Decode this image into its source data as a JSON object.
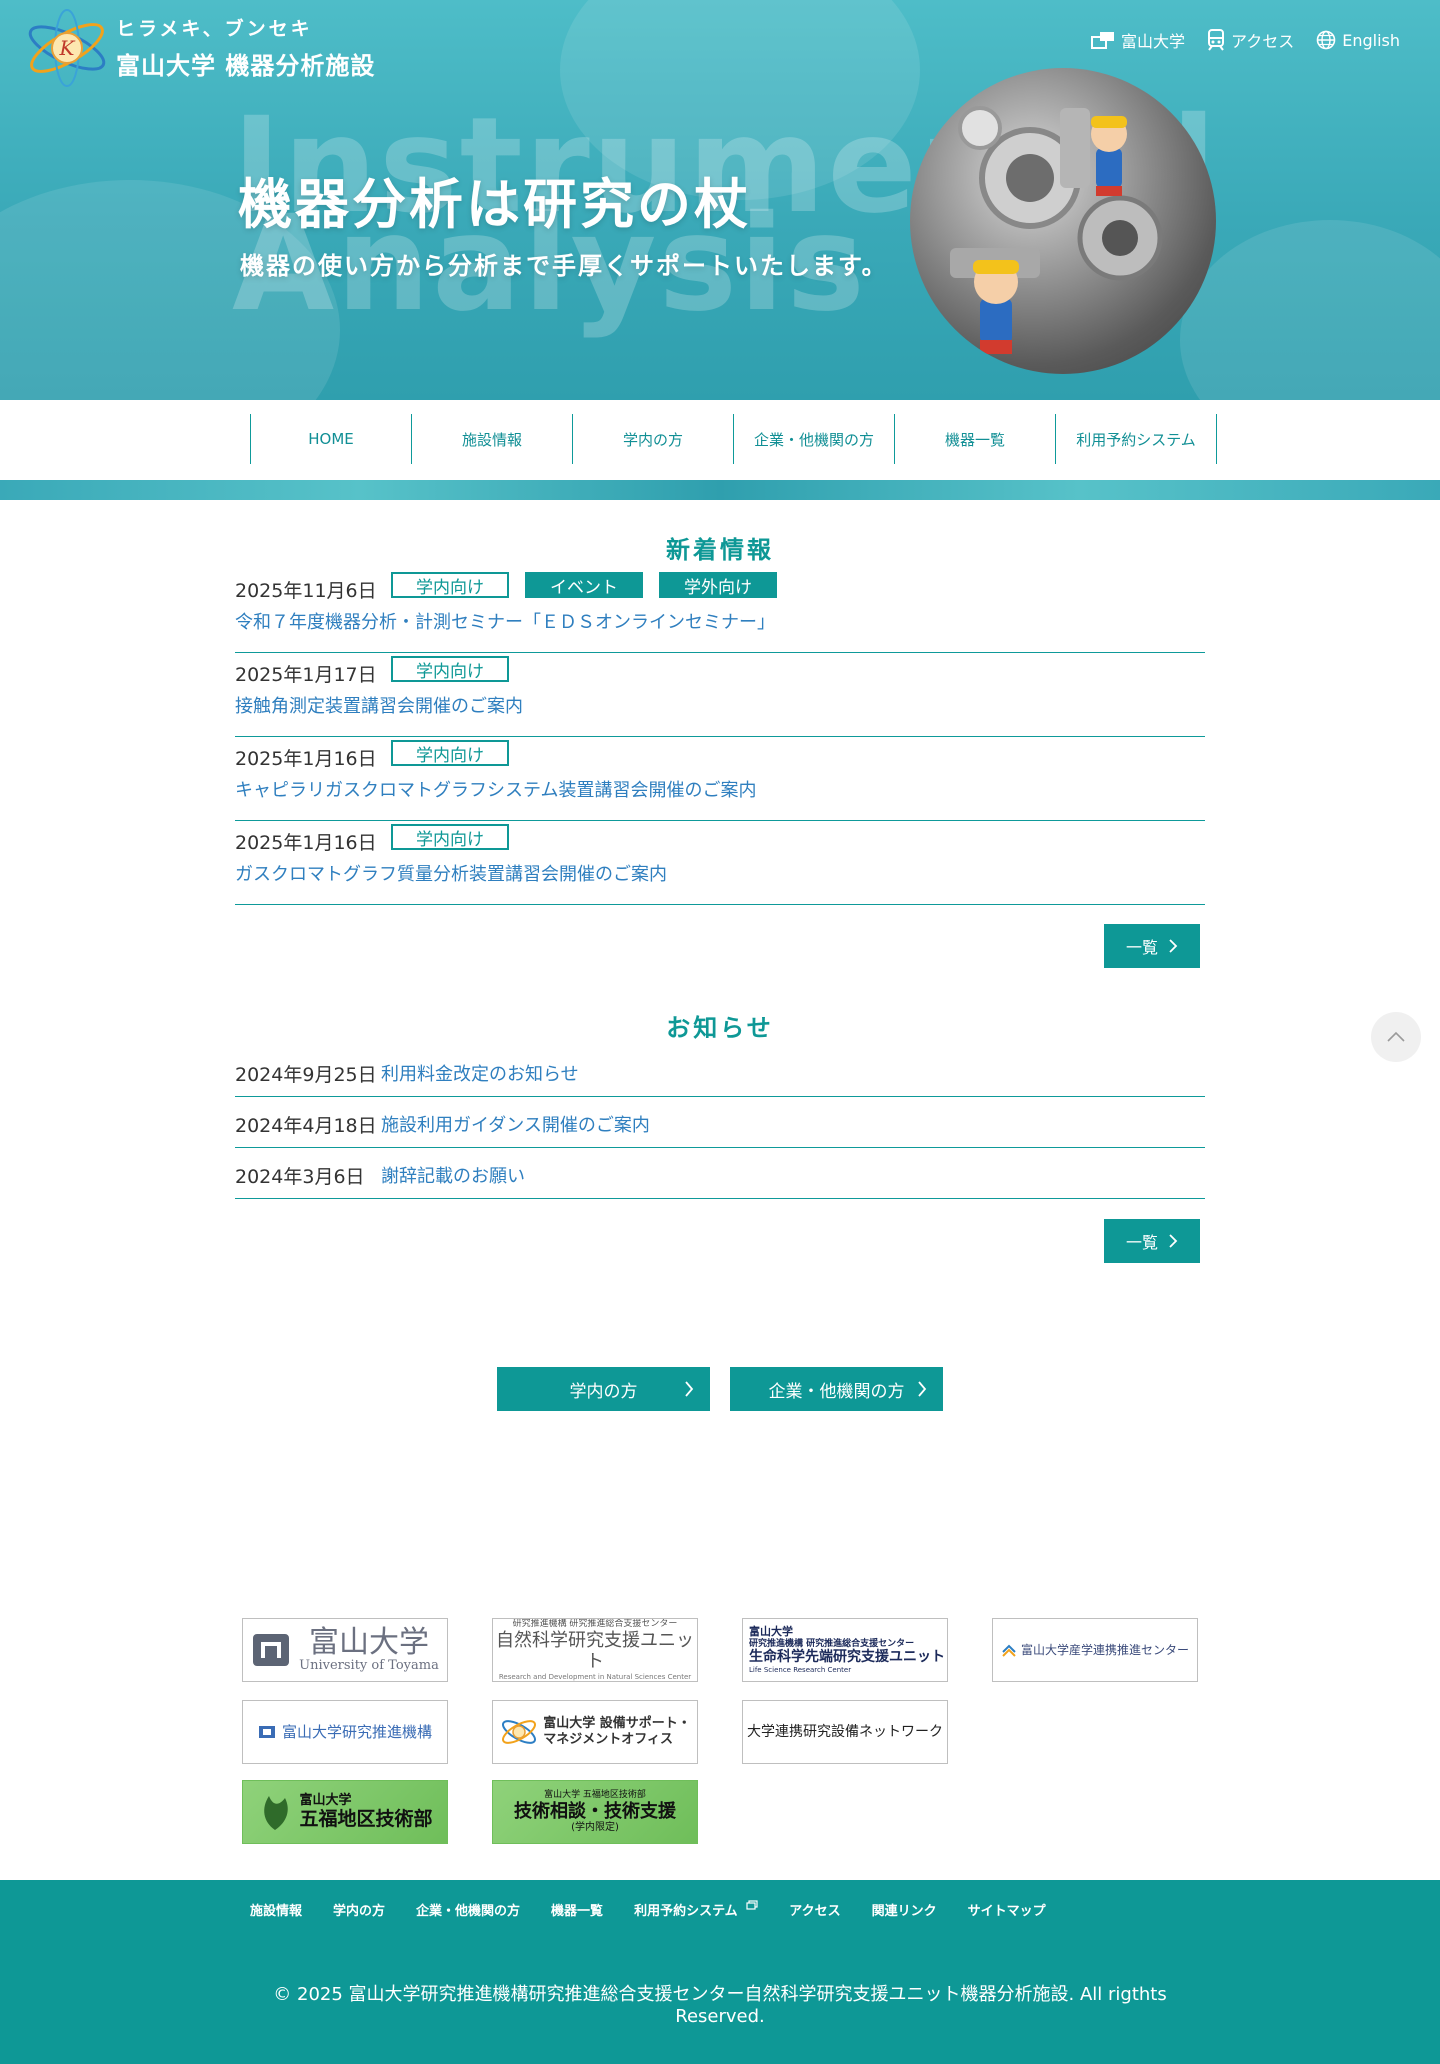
{
  "header": {
    "catchphrase": "ヒラメキ、ブンセキ",
    "site_name": "富山大学  機器分析施設",
    "top_links": [
      {
        "label": "富山大学",
        "icon": "building-icon"
      },
      {
        "label": "アクセス",
        "icon": "train-icon"
      },
      {
        "label": "English",
        "icon": "globe-icon"
      }
    ]
  },
  "hero": {
    "bg_word_1": "Instrumental",
    "bg_word_2": "Analysis",
    "title": "機器分析は研究の杖",
    "subtitle": "機器の使い方から分析まで手厚くサポートいたします。"
  },
  "nav": {
    "items": [
      "HOME",
      "施設情報",
      "学内の方",
      "企業・他機関の方",
      "機器一覧",
      "利用予約システム"
    ]
  },
  "news": {
    "heading": "新着情報",
    "items": [
      {
        "date": "2025年11月6日",
        "tags": [
          "学内向け",
          "イベント",
          "学外向け"
        ],
        "title": "令和７年度機器分析・計測セミナー「ＥＤＳオンラインセミナー」"
      },
      {
        "date": "2025年1月17日",
        "tags": [
          "学内向け"
        ],
        "title": "接触角測定装置講習会開催のご案内"
      },
      {
        "date": "2025年1月16日",
        "tags": [
          "学内向け"
        ],
        "title": "キャピラリガスクロマトグラフシステム装置講習会開催のご案内"
      },
      {
        "date": "2025年1月16日",
        "tags": [
          "学内向け"
        ],
        "title": "ガスクロマトグラフ質量分析装置講習会開催のご案内"
      }
    ],
    "more_label": "一覧"
  },
  "notices": {
    "heading": "お知らせ",
    "items": [
      {
        "date": "2024年9月25日",
        "title": "利用料金改定のお知らせ"
      },
      {
        "date": "2024年4月18日",
        "title": "施設利用ガイダンス開催のご案内"
      },
      {
        "date": "2024年3月6日",
        "title": "謝辞記載のお願い"
      }
    ],
    "more_label": "一覧"
  },
  "cta": {
    "internal": "学内の方",
    "external": "企業・他機関の方"
  },
  "banners": {
    "uoft_name": "富山大学",
    "uoft_eng": "University of Toyama",
    "natural_small": "研究推進機構 研究推進総合支援センター",
    "natural_main": "自然科学研究支援ユニット",
    "natural_eng": "Research and Development in Natural Sciences Center",
    "life_line1": "富山大学",
    "life_line2": "研究推進機構 研究推進総合支援センター",
    "life_main": "生命科学先端研究支援ユニット",
    "life_eng": "Life Science Research Center",
    "sangaku": "富山大学産学連携推進センター",
    "kenkyu": "富山大学研究推進機構",
    "setsubi_1": "富山大学 設備サポート・",
    "setsubi_2": "マネジメントオフィス",
    "network": "大学連携研究設備ネットワーク",
    "gijutsu_1": "富山大学",
    "gijutsu_2": "五福地区技術部",
    "soudan_1": "富山大学 五福地区技術部",
    "soudan_2": "技術相談・技術支援",
    "soudan_3": "(学内限定)"
  },
  "footer": {
    "links": [
      "施設情報",
      "学内の方",
      "企業・他機関の方",
      "機器一覧",
      "利用予約システム",
      "アクセス",
      "関連リンク",
      "サイトマップ"
    ],
    "copyright_line1": "© 2025 富山大学研究推進機構研究推進総合支援センター自然科学研究支援ユニット機器分析施設. All rigthts",
    "copyright_line2": "Reserved."
  },
  "colors": {
    "brand": "#0e9896",
    "link": "#2f7fbf",
    "hero": "#3aa9b8"
  }
}
